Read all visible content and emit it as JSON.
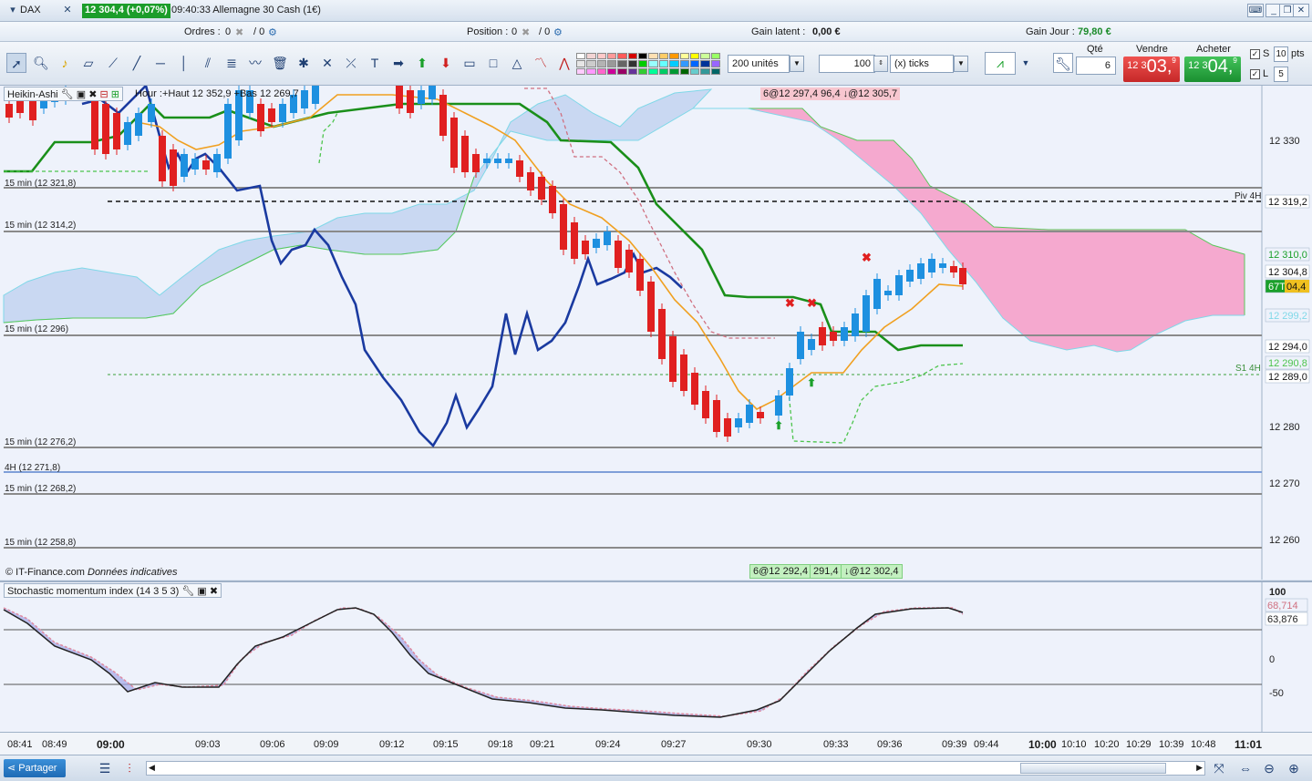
{
  "titlebar": {
    "instrument": "DAX",
    "quote": "12 304,4 (+0,07%)",
    "time_name": "09:40:33 Allemagne 30 Cash (1€)"
  },
  "infobar": {
    "orders_label": "Ordres :",
    "orders_value": "0",
    "orders_total": "/ 0",
    "position_label": "Position :",
    "position_value": "0",
    "position_total": "/ 0",
    "latent_label": "Gain latent :",
    "latent_value": "0,00 €",
    "day_label": "Gain Jour :",
    "day_value": "79,80 €"
  },
  "toolbar": {
    "units": "200 unités",
    "ticks_value": "100",
    "ticks_unit": "(x) ticks",
    "qty_label": "Qté",
    "qty_value": "6",
    "sell_label": "Vendre",
    "buy_label": "Acheter",
    "sell_small": "12 3",
    "sell_big": "03,",
    "sell_sup": "9",
    "buy_small": "12 3",
    "buy_big": "04,",
    "buy_sup": "9",
    "s_label": "S",
    "s_value": "10",
    "pts_label": "pts",
    "l_label": "L",
    "l_value": "5",
    "swatch_colors": [
      "#ffffff",
      "#f2d4d4",
      "#ffc9c9",
      "#ff9a9a",
      "#ff5a5a",
      "#d40000",
      "#000000",
      "#ffe0b3",
      "#ffcc66",
      "#ff9900",
      "#ffff99",
      "#ffff00",
      "#ccff99",
      "#99ff66",
      "#e6e6e6",
      "#cccccc",
      "#b3b3b3",
      "#999999",
      "#666666",
      "#333333",
      "#00cc00",
      "#99ffff",
      "#66ffff",
      "#00ccff",
      "#3399ff",
      "#0066ff",
      "#003399",
      "#9966ff",
      "#ffccff",
      "#ff99ff",
      "#ff66cc",
      "#cc0099",
      "#990066",
      "#663399",
      "#33cc33",
      "#00ff99",
      "#00cc66",
      "#009933",
      "#006600",
      "#66cccc",
      "#339999",
      "#006666"
    ]
  },
  "main_chart": {
    "indicator_label": "Heikin-Ashi",
    "hour_label": "Hour :+Haut 12 352,9 +Bas 12 269,7",
    "order_top": "6@12 297,4 96,4 ↓@12 305,7",
    "order_bottom_a": "6@12 292,4",
    "order_bottom_b": "291,4",
    "order_bottom_c": "↓@12 302,4",
    "copyright": "© IT-Finance.com",
    "copyright_note": "Données indicatives",
    "piv_label": "Piv 4H",
    "s1_label": "S1 4H",
    "level_labels": [
      "15 min (12 321,8)",
      "15 min (12 314,2)",
      "15 min (12 296)",
      "15 min (12 276,2)",
      "4H (12 271,8)",
      "15 min (12 268,2)",
      "15 min (12 258,8)"
    ],
    "price_ticks": [
      "12 330",
      "12 280",
      "12 270",
      "12 260"
    ],
    "price_tags": [
      "12 319,2",
      "12 310,0",
      "12 304,8",
      "67T",
      "04,4",
      "12 299,2",
      "12 294,0",
      "12 290,8",
      "12 289,0"
    ]
  },
  "osc_chart": {
    "label": "Stochastic momentum index (14 3 5 3)",
    "ticks": [
      "100",
      "0",
      "-50"
    ],
    "tags": [
      "68,714",
      "63,876"
    ]
  },
  "time_axis": [
    "08:41",
    "08:49",
    "09:00",
    "09:03",
    "09:06",
    "09:09",
    "09:12",
    "09:15",
    "09:18",
    "09:21",
    "09:24",
    "09:27",
    "09:30",
    "09:33",
    "09:36",
    "09:39",
    "09:44",
    "10:00",
    "10:10",
    "10:20",
    "10:29",
    "10:39",
    "10:48",
    "11:01"
  ],
  "bottombar": {
    "share_label": "Partager"
  },
  "colors": {
    "bull": "#1e90e0",
    "bear": "#e02020",
    "kijun": "#1a8f1a",
    "tenkan": "#f0a020",
    "blue_line": "#1a3aa0",
    "cloud_bull": "#c9d8f2",
    "cloud_bear": "#f5a9cf"
  }
}
